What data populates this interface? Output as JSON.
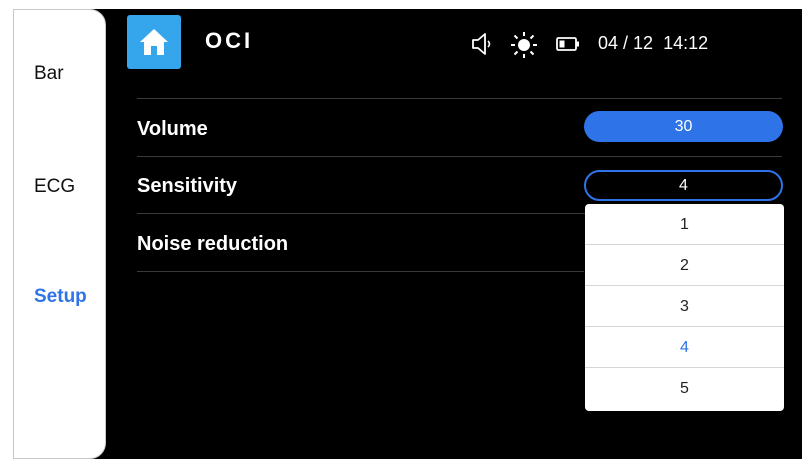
{
  "header": {
    "title": "OCI",
    "status_icons": [
      "speaker-icon",
      "brightness-icon",
      "battery-icon"
    ],
    "date": "04 / 12",
    "time": "14:12"
  },
  "sidebar": {
    "items": [
      {
        "label": "Bar",
        "active": false
      },
      {
        "label": "ECG",
        "active": false
      },
      {
        "label": "Setup",
        "active": true
      }
    ]
  },
  "settings": {
    "volume": {
      "label": "Volume",
      "value": "30"
    },
    "sensitivity": {
      "label": "Sensitivity",
      "value": "4"
    },
    "noise_reduction": {
      "label": "Noise reduction"
    }
  },
  "dropdown": {
    "options": [
      "1",
      "2",
      "3",
      "4",
      "5"
    ],
    "selected": "4"
  },
  "colors": {
    "accent": "#2e74e8",
    "home_button": "#36a6ec",
    "background": "#000000"
  }
}
